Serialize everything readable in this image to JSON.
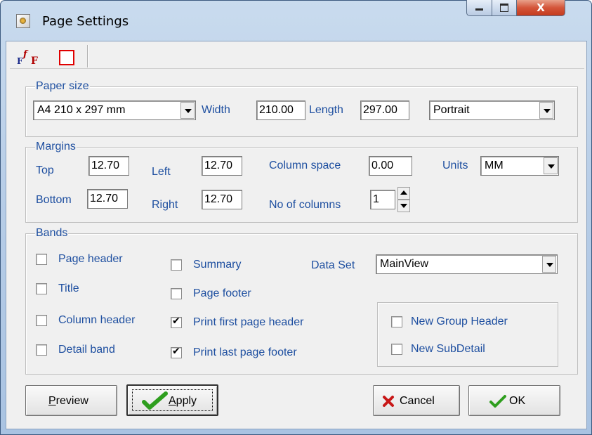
{
  "window": {
    "title": "Page Settings",
    "close_glyph": "X"
  },
  "toolbar": {
    "font_button_icon": "font-style-icon",
    "border_button_icon": "border-frame-icon",
    "font_glyphs": [
      "F",
      "f",
      "F"
    ]
  },
  "paper_size": {
    "group_label": "Paper size",
    "size_value": "A4 210 x 297 mm",
    "width_label": "Width",
    "width_value": "210.00",
    "length_label": "Length",
    "length_value": "297.00",
    "orientation_value": "Portrait"
  },
  "margins": {
    "group_label": "Margins",
    "top_label": "Top",
    "top_value": "12.70",
    "bottom_label": "Bottom",
    "bottom_value": "12.70",
    "left_label": "Left",
    "left_value": "12.70",
    "right_label": "Right",
    "right_value": "12.70",
    "column_space_label": "Column space",
    "column_space_value": "0.00",
    "no_of_columns_label": "No of columns",
    "no_of_columns_value": "1",
    "units_label": "Units",
    "units_value": "MM"
  },
  "bands": {
    "group_label": "Bands",
    "page_header": {
      "label": "Page header",
      "checked": false
    },
    "title": {
      "label": "Title",
      "checked": false
    },
    "column_header": {
      "label": "Column header",
      "checked": false
    },
    "detail_band": {
      "label": "Detail band",
      "checked": false
    },
    "summary": {
      "label": "Summary",
      "checked": false
    },
    "page_footer": {
      "label": "Page footer",
      "checked": false
    },
    "print_first_page_header": {
      "label": "Print first page header",
      "checked": true
    },
    "print_last_page_footer": {
      "label": "Print last page footer",
      "checked": true
    },
    "data_set_label": "Data Set",
    "data_set_value": "MainView",
    "new_group_header": {
      "label": "New Group Header",
      "checked": false
    },
    "new_subdetail": {
      "label": "New SubDetail",
      "checked": false
    }
  },
  "buttons": {
    "preview_label": "Preview",
    "apply_label": "Apply",
    "cancel_label": "Cancel",
    "ok_label": "OK"
  },
  "colors": {
    "label_blue": "#1e4fa0",
    "check_green": "#2e9e1e",
    "cancel_red": "#c81818"
  }
}
